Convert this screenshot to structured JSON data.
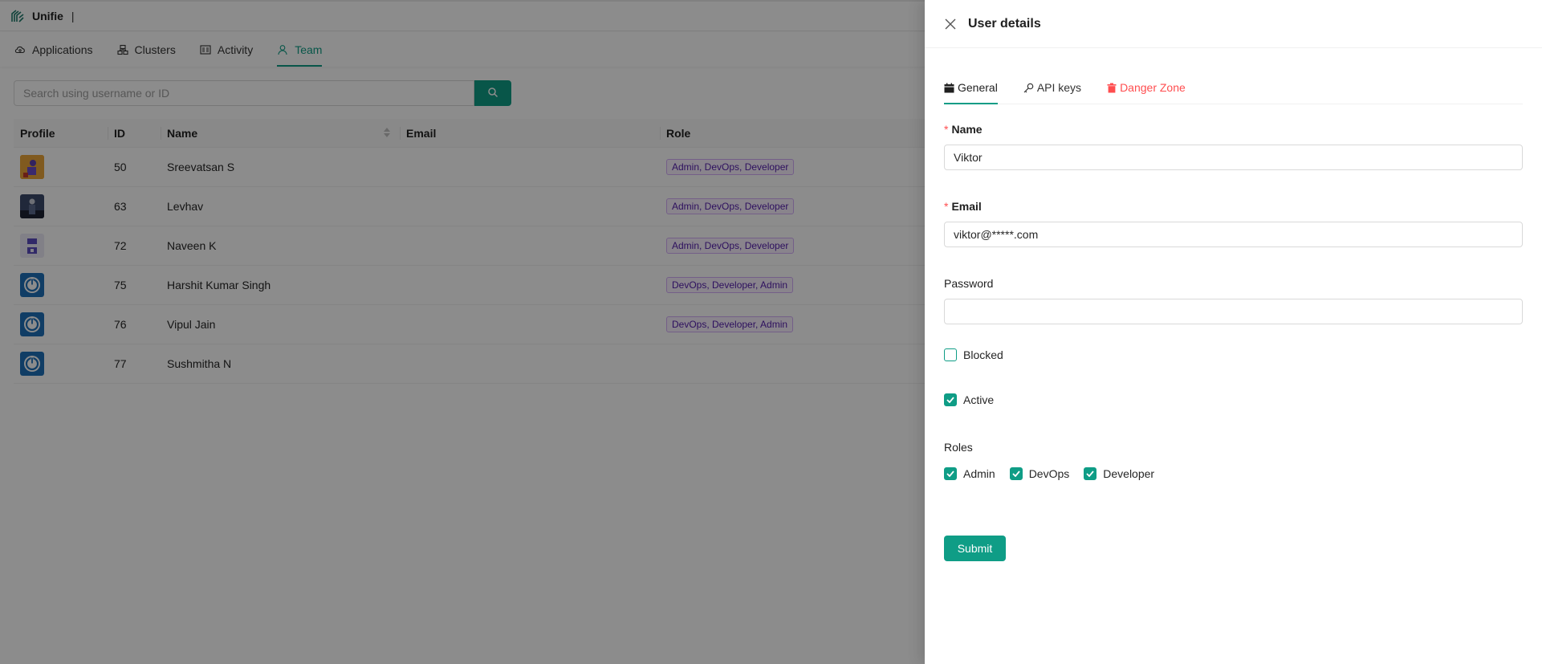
{
  "app": {
    "name": "Unifie",
    "title_separator": "|"
  },
  "nav": {
    "items": [
      {
        "label": "Applications",
        "icon": "cloud-icon"
      },
      {
        "label": "Clusters",
        "icon": "cluster-icon"
      },
      {
        "label": "Activity",
        "icon": "activity-icon"
      },
      {
        "label": "Team",
        "icon": "user-icon",
        "active": true
      }
    ]
  },
  "search": {
    "placeholder": "Search using username or ID",
    "value": ""
  },
  "table": {
    "headers": {
      "profile": "Profile",
      "id": "ID",
      "name": "Name",
      "email": "Email",
      "role": "Role"
    },
    "rows": [
      {
        "id": "50",
        "name": "Sreevatsan S",
        "email": "",
        "role": "Admin, DevOps, Developer"
      },
      {
        "id": "63",
        "name": "Levhav",
        "email": "",
        "role": "Admin, DevOps, Developer"
      },
      {
        "id": "72",
        "name": "Naveen K",
        "email": "",
        "role": "Admin, DevOps, Developer"
      },
      {
        "id": "75",
        "name": "Harshit Kumar Singh",
        "email": "",
        "role": "DevOps, Developer, Admin"
      },
      {
        "id": "76",
        "name": "Vipul Jain",
        "email": "",
        "role": "DevOps, Developer, Admin"
      },
      {
        "id": "77",
        "name": "Sushmitha N",
        "email": "",
        "role": ""
      }
    ]
  },
  "drawer": {
    "title": "User details",
    "tabs": [
      {
        "label": "General",
        "icon": "calendar-icon",
        "active": true
      },
      {
        "label": "API keys",
        "icon": "key-icon"
      },
      {
        "label": "Danger Zone",
        "icon": "trash-icon",
        "danger": true
      }
    ],
    "form": {
      "required_mark": "*",
      "name_label": "Name",
      "name_value": "Viktor",
      "email_label": "Email",
      "email_value": "viktor@*****.com",
      "password_label": "Password",
      "password_value": "",
      "blocked_label": "Blocked",
      "blocked_checked": false,
      "active_label": "Active",
      "active_checked": true,
      "roles_label": "Roles",
      "roles": [
        {
          "label": "Admin",
          "checked": true
        },
        {
          "label": "DevOps",
          "checked": true
        },
        {
          "label": "Developer",
          "checked": true
        }
      ],
      "submit_label": "Submit"
    }
  },
  "colors": {
    "accent": "#0f9d86",
    "danger": "#ff4d4f",
    "tag_text": "#531dab",
    "tag_bg": "#f9f0ff",
    "tag_border": "#d3adf7"
  }
}
